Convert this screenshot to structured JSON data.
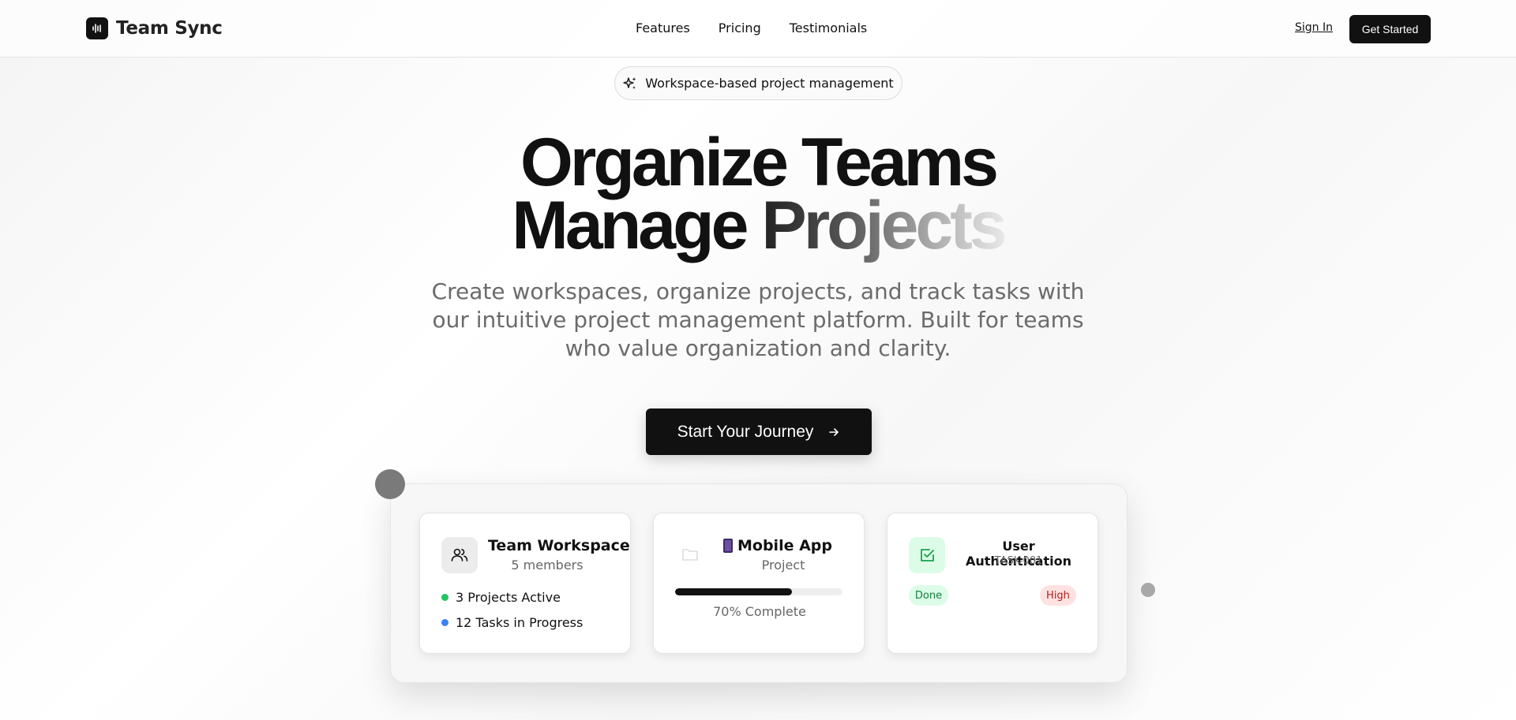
{
  "nav": {
    "brand": "Team Sync",
    "links": [
      "Features",
      "Pricing",
      "Testimonials"
    ],
    "sign_in": "Sign In",
    "get_started": "Get Started"
  },
  "hero": {
    "pill": "Workspace-based project management",
    "line1": "Organize Teams",
    "line2_plain": "Manage ",
    "line2_gradient": "Projects",
    "subtitle": "Create workspaces, organize projects, and track tasks with our intuitive project management platform. Built for teams who value organization and clarity.",
    "cta": "Start Your Journey"
  },
  "preview": {
    "workspace": {
      "title": "Team Workspace",
      "members": "5 members",
      "stats": [
        {
          "text": "3 Projects Active",
          "color": "#22c55e"
        },
        {
          "text": "12 Tasks in Progress",
          "color": "#3b82f6"
        }
      ]
    },
    "project": {
      "title": "Mobile App",
      "type": "Project",
      "progress": 0.7,
      "progress_text": "70% Complete"
    },
    "task": {
      "title": "User Authentication",
      "id": "TASK-001",
      "status": "Done",
      "priority": "High"
    }
  },
  "colors": {
    "primary": "#111111",
    "done_bg": "#dcfce7",
    "done_text": "#15803d",
    "high_bg": "#fee2e2",
    "high_text": "#b91c1c"
  }
}
